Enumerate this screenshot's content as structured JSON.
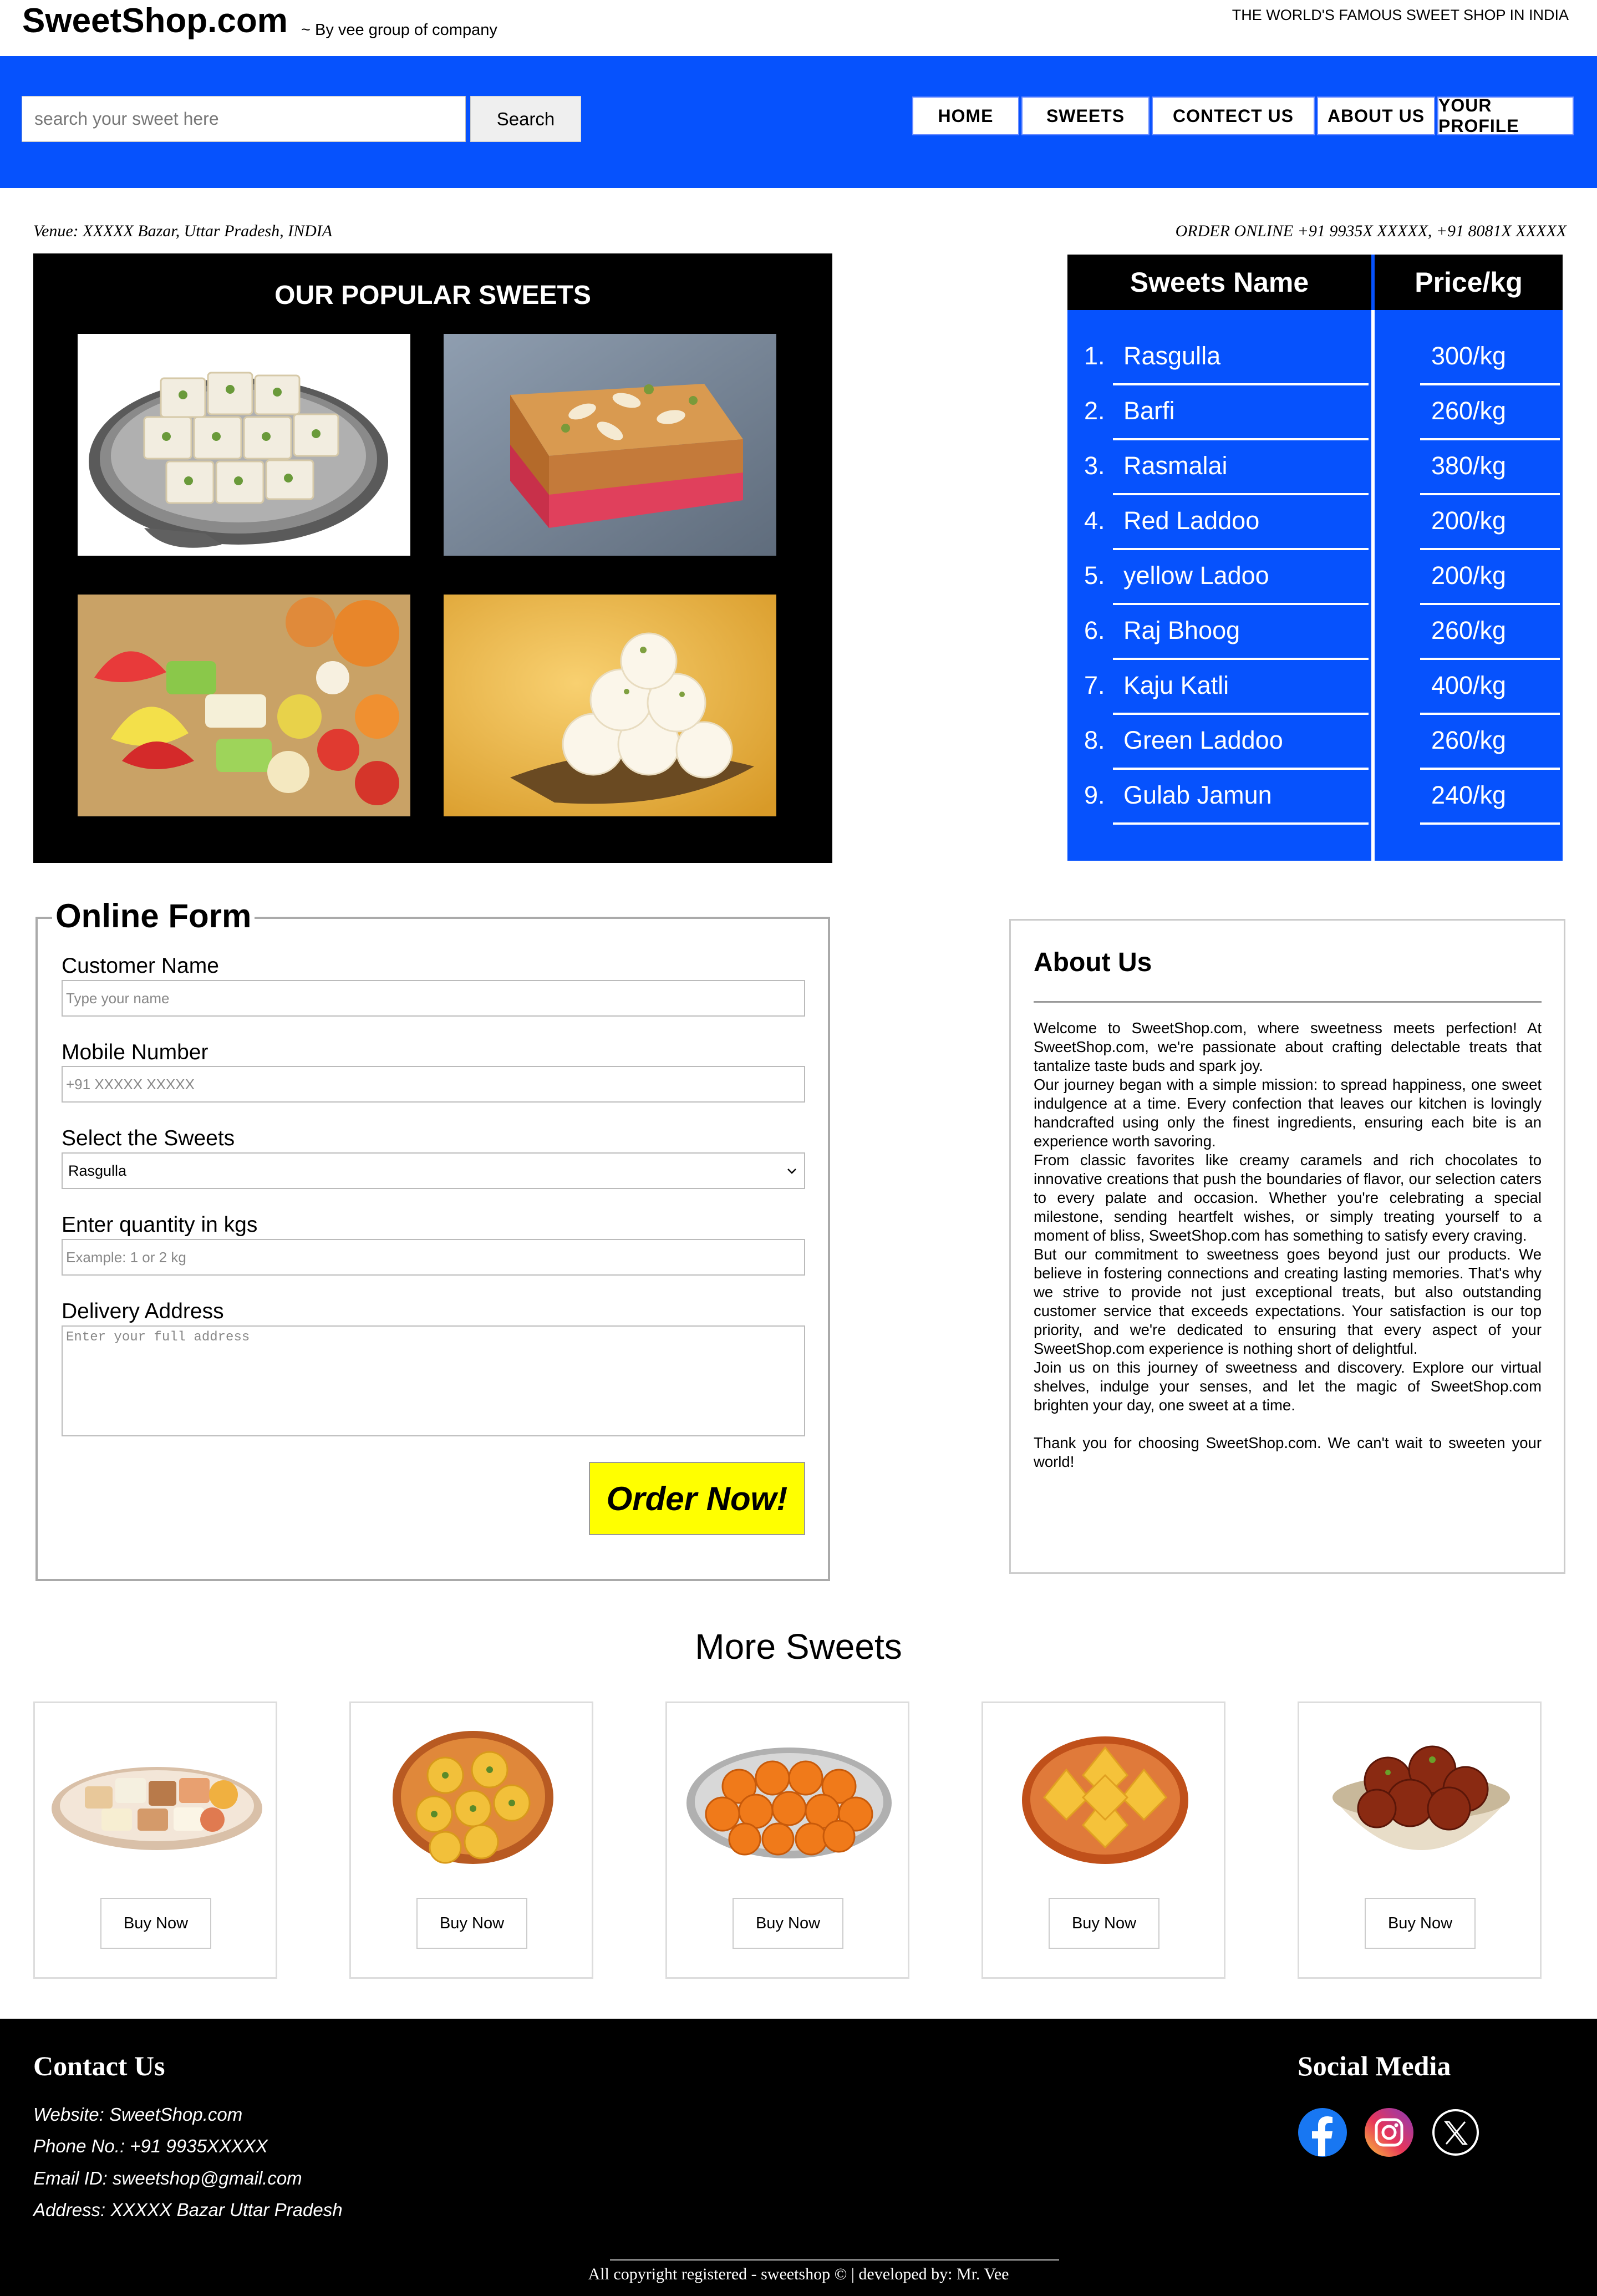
{
  "site": {
    "brand": "SweetShop.com",
    "byline": "~ By vee group of company",
    "tagline": "THE WORLD'S FAMOUS SWEET SHOP IN INDIA"
  },
  "header": {
    "search_placeholder": "search your sweet here",
    "search_label": "Search",
    "nav": [
      "HOME",
      "SWEETS",
      "CONTECT US",
      "ABOUT US",
      "YOUR PROFILE"
    ],
    "accent_color": "#0652fd"
  },
  "info": {
    "venue": "Venue: XXXXX Bazar, Uttar Pradesh, INDIA",
    "order_online": "ORDER ONLINE +91 9935X XXXXX, +91 8081X XXXXX"
  },
  "popular": {
    "title": "OUR POPULAR SWEETS",
    "photos": [
      "kalakand-photo",
      "cake-burfi-photo",
      "assorted-sweets-photo",
      "rasgulla-photo"
    ]
  },
  "price_table": {
    "headers": [
      "Sweets Name",
      "Price/kg"
    ],
    "rows": [
      {
        "num": "1.",
        "name": "Rasgulla",
        "price": "300/kg"
      },
      {
        "num": "2.",
        "name": "Barfi",
        "price": "260/kg"
      },
      {
        "num": "3.",
        "name": "Rasmalai",
        "price": "380/kg"
      },
      {
        "num": "4.",
        "name": "Red Laddoo",
        "price": "200/kg"
      },
      {
        "num": "5.",
        "name": "yellow Ladoo",
        "price": "200/kg"
      },
      {
        "num": "6.",
        "name": "Raj Bhoog",
        "price": "260/kg"
      },
      {
        "num": "7.",
        "name": "Kaju Katli",
        "price": "400/kg"
      },
      {
        "num": "8.",
        "name": "Green Laddoo",
        "price": "260/kg"
      },
      {
        "num": "9.",
        "name": "Gulab Jamun",
        "price": "240/kg"
      }
    ]
  },
  "form": {
    "legend": "Online Form",
    "name_label": "Customer Name",
    "name_placeholder": "Type your name",
    "mobile_label": "Mobile Number",
    "mobile_placeholder": "+91 XXXXX XXXXX",
    "sweets_label": "Select the Sweets",
    "sweets_selected": "Rasgulla",
    "qty_label": "Enter quantity in kgs",
    "qty_placeholder": "Example: 1 or 2 kg",
    "address_label": "Delivery Address",
    "address_placeholder": "Enter your full address",
    "order_label": "Order Now!",
    "order_color": "#ffff00"
  },
  "about": {
    "title": "About Us",
    "paragraphs": [
      "Welcome to SweetShop.com, where sweetness meets perfection! At SweetShop.com, we're passionate about crafting delectable treats that tantalize taste buds and spark joy.",
      "Our journey began with a simple mission: to spread happiness, one sweet indulgence at a time. Every confection that leaves our kitchen is lovingly handcrafted using only the finest ingredients, ensuring each bite is an experience worth savoring.",
      "From classic favorites like creamy caramels and rich chocolates to innovative creations that push the boundaries of flavor, our selection caters to every palate and occasion. Whether you're celebrating a special milestone, sending heartfelt wishes, or simply treating yourself to a moment of bliss, SweetShop.com has something to satisfy every craving.",
      "But our commitment to sweetness goes beyond just our products. We believe in fostering connections and creating lasting memories. That's why we strive to provide not just exceptional treats, but also outstanding customer service that exceeds expectations. Your satisfaction is our top priority, and we're dedicated to ensuring that every aspect of your SweetShop.com experience is nothing short of delightful.",
      "Join us on this journey of sweetness and discovery. Explore our virtual shelves, indulge your senses, and let the magic of SweetShop.com brighten your day, one sweet at a time.",
      "Thank you for choosing SweetShop.com. We can't wait to sweeten your world!"
    ]
  },
  "more_sweets": {
    "title": "More Sweets",
    "buy_label": "Buy Now",
    "items": [
      "mixed-sweets-plate",
      "kesar-peda-plate",
      "motichoor-laddoo-plate",
      "kaju-katli-plate",
      "gulab-jamun-bowl"
    ]
  },
  "footer": {
    "contact_title": "Contact Us",
    "website": "Website: SweetShop.com",
    "phone": "Phone No.: +91 9935XXXXX",
    "email": "Email ID: sweetshop@gmail.com",
    "address": "Address: XXXXX Bazar Uttar Pradesh",
    "social_title": "Social Media",
    "social_icons": [
      "facebook-icon",
      "instagram-icon",
      "x-icon"
    ],
    "copyright": "All copyright registered - sweetshop © | developed by: Mr. Vee"
  }
}
